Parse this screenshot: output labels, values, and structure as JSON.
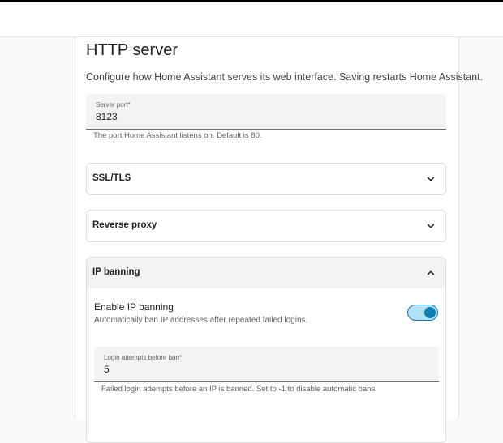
{
  "page": {
    "title": "HTTP server",
    "description": "Configure how Home Assistant serves its web interface. Saving restarts Home Assistant."
  },
  "server_port": {
    "label": "Server port*",
    "value": "8123",
    "helper": "The port Home Assistant listens on. Default is 80."
  },
  "sections": {
    "ssl": {
      "title": "SSL/TLS",
      "expanded": false
    },
    "reverse_proxy": {
      "title": "Reverse proxy",
      "expanded": false
    },
    "ip_banning": {
      "title": "IP banning",
      "expanded": true
    }
  },
  "ip_banning": {
    "toggle_title": "Enable IP banning",
    "toggle_description": "Automatically ban IP addresses after repeated failed logins.",
    "enabled": true,
    "login_attempts": {
      "label": "Login attempts before ban*",
      "value": "5",
      "helper": "Failed login attempts before an IP is banned. Set to -1 to disable automatic bans."
    }
  },
  "colors": {
    "accent": "#0d7fb5",
    "switch_track": "#b3e0f2",
    "field_background": "#f3f3f3"
  },
  "icons": {
    "collapsed": "chevron-down-icon",
    "expanded": "chevron-up-icon"
  }
}
